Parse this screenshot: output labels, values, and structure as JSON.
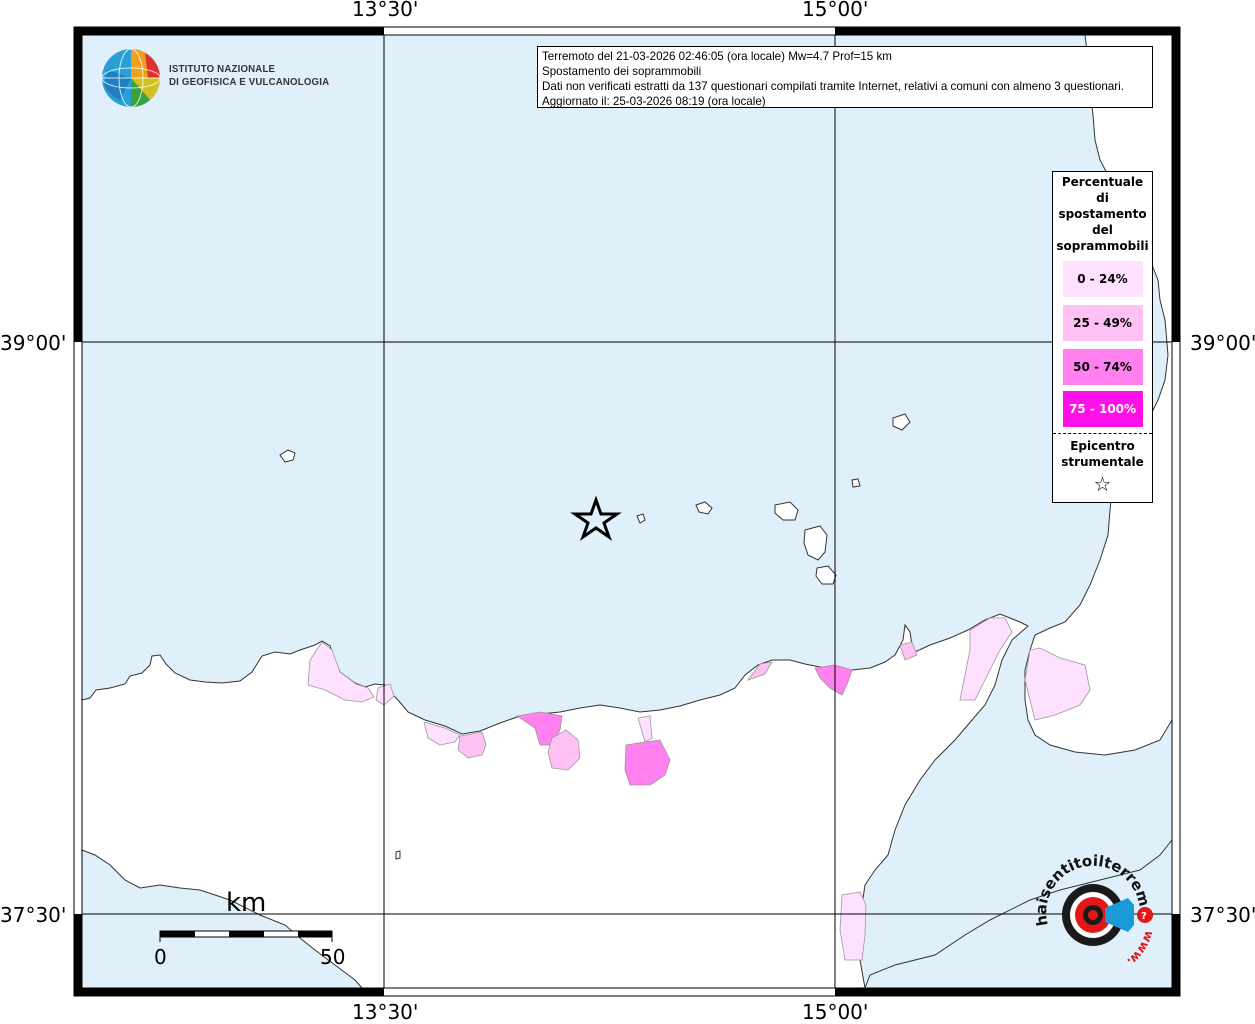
{
  "info": {
    "line1": "Terremoto del 21-03-2026 02:46:05 (ora locale) Mw=4.7 Prof=15 km",
    "line2": "Spostamento dei soprammobili",
    "line3": "Dati non verificati estratti da 137 questionari compilati tramite Internet, relativi a comuni con almeno 3 questionari.",
    "line4": "Aggiornato il: 25-03-2026 08:19 (ora locale)"
  },
  "logo": {
    "line1": "ISTITUTO NAZIONALE",
    "line2": "DI GEOFISICA E VULCANOLOGIA"
  },
  "axes": {
    "top": [
      "13°30'",
      "15°00'"
    ],
    "bottom": [
      "13°30'",
      "15°00'"
    ],
    "left": [
      "39°00'",
      "37°30'"
    ],
    "right": [
      "39°00'",
      "37°30'"
    ]
  },
  "legend": {
    "title": "Percentuale di spostamento del soprammobili",
    "classes": [
      {
        "label": "0 - 24%",
        "color": "#ffe0ff"
      },
      {
        "label": "25 - 49%",
        "color": "#ffc0f4"
      },
      {
        "label": "50 - 74%",
        "color": "#ff80ee"
      },
      {
        "label": "75 - 100%",
        "color": "#ff10e8"
      }
    ],
    "epicenter_label": "Epicentro strumentale",
    "epicenter_symbol": "☆"
  },
  "scalebar": {
    "unit": "km",
    "start": "0",
    "end": "50"
  },
  "watermark": {
    "text": "haisentitoilterremoto.it",
    "prefix": "www."
  },
  "colors": {
    "sea": "#dff0fb",
    "land": "#ffffff",
    "coast": "#333333"
  }
}
